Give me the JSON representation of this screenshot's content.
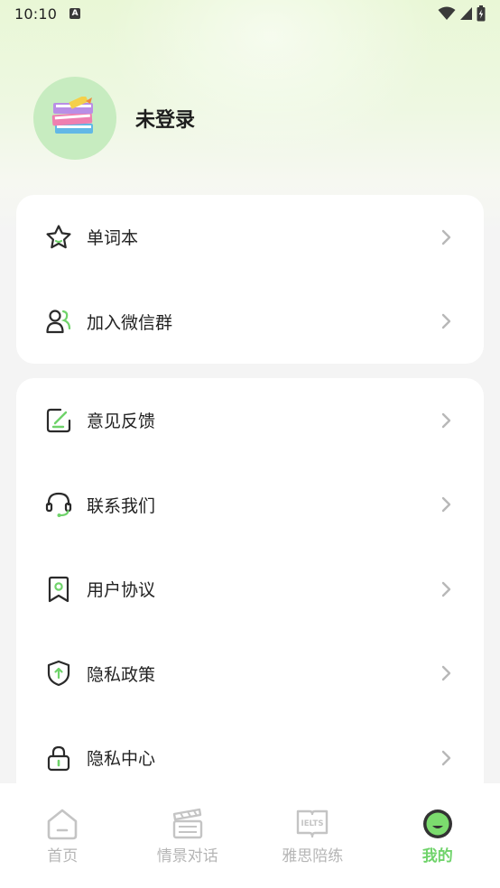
{
  "status_bar": {
    "time": "10:10",
    "notif_letter": "A"
  },
  "profile": {
    "name": "未登录",
    "avatar_icon": "books-icon"
  },
  "colors": {
    "accent": "#6fd36a",
    "avatar_bg": "#c7ecc0",
    "inactive": "#b5b5b5"
  },
  "menu_group_1": [
    {
      "label": "单词本",
      "icon": "star-icon"
    },
    {
      "label": "加入微信群",
      "icon": "group-icon"
    }
  ],
  "menu_group_2": [
    {
      "label": "意见反馈",
      "icon": "feedback-icon"
    },
    {
      "label": "联系我们",
      "icon": "headset-icon"
    },
    {
      "label": "用户协议",
      "icon": "bookmark-icon"
    },
    {
      "label": "隐私政策",
      "icon": "shield-icon"
    },
    {
      "label": "隐私中心",
      "icon": "lock-icon"
    }
  ],
  "tabs": [
    {
      "label": "首页",
      "icon": "home-icon",
      "active": false
    },
    {
      "label": "情景对话",
      "icon": "clapperboard-icon",
      "active": false
    },
    {
      "label": "雅思陪练",
      "icon": "ielts-book-icon",
      "icon_text": "IELTS",
      "active": false
    },
    {
      "label": "我的",
      "icon": "profile-face-icon",
      "active": true
    }
  ]
}
